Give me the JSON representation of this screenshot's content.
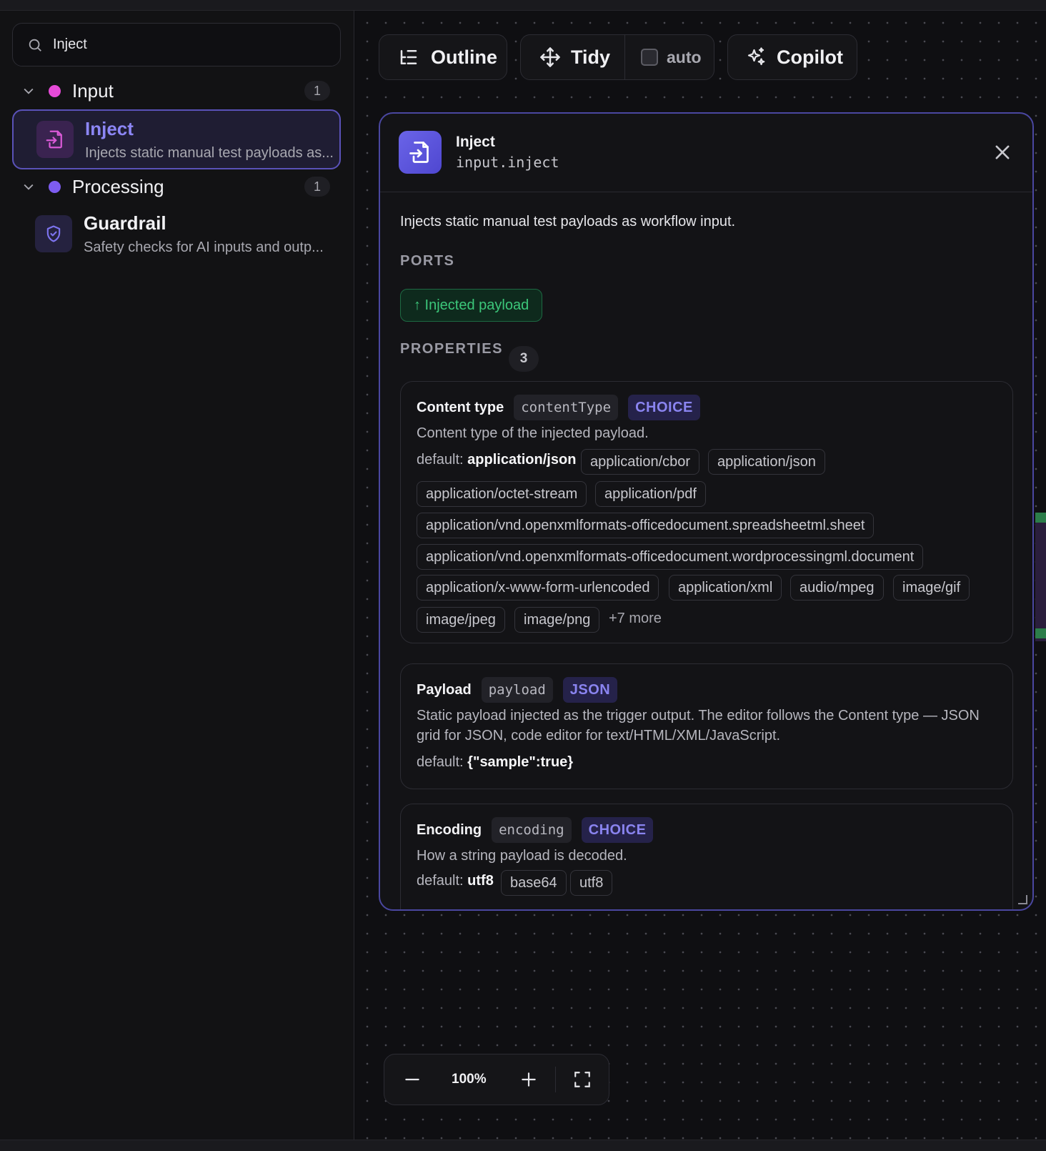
{
  "search": {
    "value": "Inject"
  },
  "sidebar": {
    "groups": [
      {
        "name": "Input",
        "count": "1",
        "color": "#e64ad8"
      },
      {
        "name": "Processing",
        "count": "1",
        "color": "#7d5cf0"
      }
    ],
    "items": [
      {
        "title": "Inject",
        "desc": "Injects static manual test payloads as...",
        "icon": "file-import-icon"
      },
      {
        "title": "Guardrail",
        "desc": "Safety checks for AI inputs and outp...",
        "icon": "shield-check-icon"
      }
    ]
  },
  "toolbar": {
    "outline": "Outline",
    "tidy": "Tidy",
    "auto": "auto",
    "copilot": "Copilot"
  },
  "panel": {
    "title": "Inject",
    "subtitle": "input.inject",
    "description": "Injects static manual test payloads as workflow input.",
    "ports_heading": "PORTS",
    "port_label": "↑ Injected payload",
    "properties_heading": "PROPERTIES",
    "properties_count": "3",
    "properties": [
      {
        "name": "Content type",
        "key": "contentType",
        "type": "CHOICE",
        "description": "Content type of the injected payload.",
        "default_label": "default:",
        "default_value": "application/json",
        "options": [
          "application/cbor",
          "application/json",
          "application/octet-stream",
          "application/pdf",
          "application/vnd.openxmlformats-officedocument.spreadsheetml.sheet",
          "application/vnd.openxmlformats-officedocument.wordprocessingml.document",
          "application/x-www-form-urlencoded",
          "application/xml",
          "audio/mpeg",
          "image/gif",
          "image/jpeg",
          "image/png"
        ],
        "more": "+7 more"
      },
      {
        "name": "Payload",
        "key": "payload",
        "type": "JSON",
        "description_line1": "Static payload injected as the trigger output. The editor follows the Content type — JSON",
        "description_line2": "grid for JSON, code editor for text/HTML/XML/JavaScript.",
        "default_label": "default:",
        "default_value": "{\"sample\":true}"
      },
      {
        "name": "Encoding",
        "key": "encoding",
        "type": "CHOICE",
        "description": "How a string payload is decoded.",
        "default_label": "default:",
        "default_value": "utf8",
        "options": [
          "base64",
          "utf8"
        ]
      }
    ]
  },
  "zoom": {
    "level": "100%"
  },
  "colors": {
    "accent": "#6a64e8",
    "port_green": "#3cc77a",
    "type_purple": "#8a84f0"
  }
}
